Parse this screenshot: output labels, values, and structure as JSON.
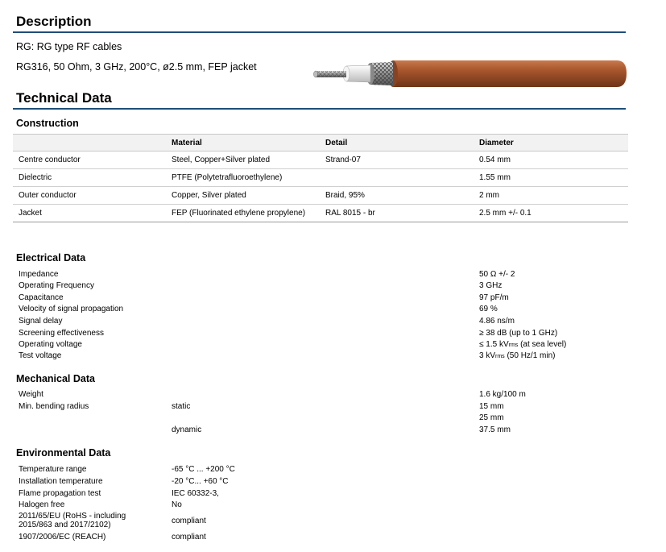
{
  "description": {
    "heading": "Description",
    "line1": "RG: RG type RF cables",
    "line2": "RG316, 50 Ohm, 3 GHz, 200°C, ø2.5 mm, FEP jacket"
  },
  "technical": {
    "heading": "Technical Data"
  },
  "construction": {
    "heading": "Construction",
    "columns": [
      "",
      "Material",
      "Detail",
      "Diameter"
    ],
    "rows": [
      [
        "Centre conductor",
        "Steel, Copper+Silver plated",
        "Strand-07",
        "0.54 mm"
      ],
      [
        "Dielectric",
        "PTFE (Polytetrafluoroethylene)",
        "",
        "1.55 mm"
      ],
      [
        "Outer conductor",
        "Copper, Silver plated",
        "Braid, 95%",
        "2 mm"
      ],
      [
        "Jacket",
        "FEP (Fluorinated ethylene propylene)",
        "RAL 8015 - br",
        "2.5 mm +/- 0.1"
      ]
    ]
  },
  "electrical": {
    "heading": "Electrical Data",
    "rows": [
      {
        "label": "Impedance",
        "value": "50 Ω +/- 2"
      },
      {
        "label": "Operating Frequency",
        "value": "3 GHz"
      },
      {
        "label": "Capacitance",
        "value": "97 pF/m"
      },
      {
        "label": "Velocity of signal propagation",
        "value": "69 %"
      },
      {
        "label": "Signal delay",
        "value": "4.86 ns/m"
      },
      {
        "label": "Screening effectiveness",
        "value": "≥ 38 dB (up to 1 GHz)"
      },
      {
        "label": "Operating voltage",
        "value_pre": "≤ 1.5 kV",
        "value_sub": "rms",
        "value_post": " (at sea level)"
      },
      {
        "label": "Test voltage",
        "value_pre": "3 kV",
        "value_sub": "rms",
        "value_post": " (50 Hz/1 min)"
      }
    ]
  },
  "mechanical": {
    "heading": "Mechanical Data",
    "weight_label": "Weight",
    "weight_value": "1.6 kg/100 m",
    "bend_label": "Min. bending radius",
    "static_label": "static",
    "static_value1": "15 mm",
    "static_value2": "25 mm",
    "dynamic_label": "dynamic",
    "dynamic_value": "37.5 mm"
  },
  "environmental": {
    "heading": "Environmental Data",
    "rows": [
      {
        "label": "Temperature range",
        "value": "-65 °C ... +200 °C"
      },
      {
        "label": "Installation temperature",
        "value": "-20 °C... +60 °C"
      },
      {
        "label": "Flame propagation test",
        "value": "IEC 60332-3,"
      },
      {
        "label": "Halogen free",
        "value": "No"
      }
    ],
    "rohs_label_1": "2011/65/EU (RoHS - including",
    "rohs_label_2": "2015/863 and 2017/2102)",
    "rohs_value": "compliant",
    "reach_label": "1907/2006/EC (REACH)",
    "reach_value": "compliant"
  },
  "colors": {
    "rule": "#1f4e79",
    "jacket": "#a0522d"
  },
  "cable_image": "coax-cable-illustration"
}
